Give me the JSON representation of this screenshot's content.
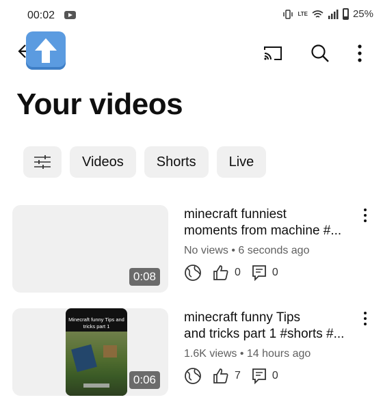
{
  "status_bar": {
    "time": "00:02",
    "network": "LTE",
    "battery": "25%"
  },
  "header": {
    "title": "Your videos"
  },
  "chips": [
    "Videos",
    "Shorts",
    "Live"
  ],
  "videos": [
    {
      "title_line1": "minecraft funniest",
      "title_line2": "moments from machine #...",
      "meta": "No views • 6 seconds ago",
      "likes": "0",
      "comments": "0",
      "duration": "0:08"
    },
    {
      "title_line1": "minecraft funny Tips",
      "title_line2": "and tricks part 1 #shorts #...",
      "meta": "1.6K views • 14 hours ago",
      "likes": "7",
      "comments": "0",
      "duration": "0:06",
      "thumbnail_caption": "Minecraft funny Tips and tricks part 1"
    }
  ]
}
